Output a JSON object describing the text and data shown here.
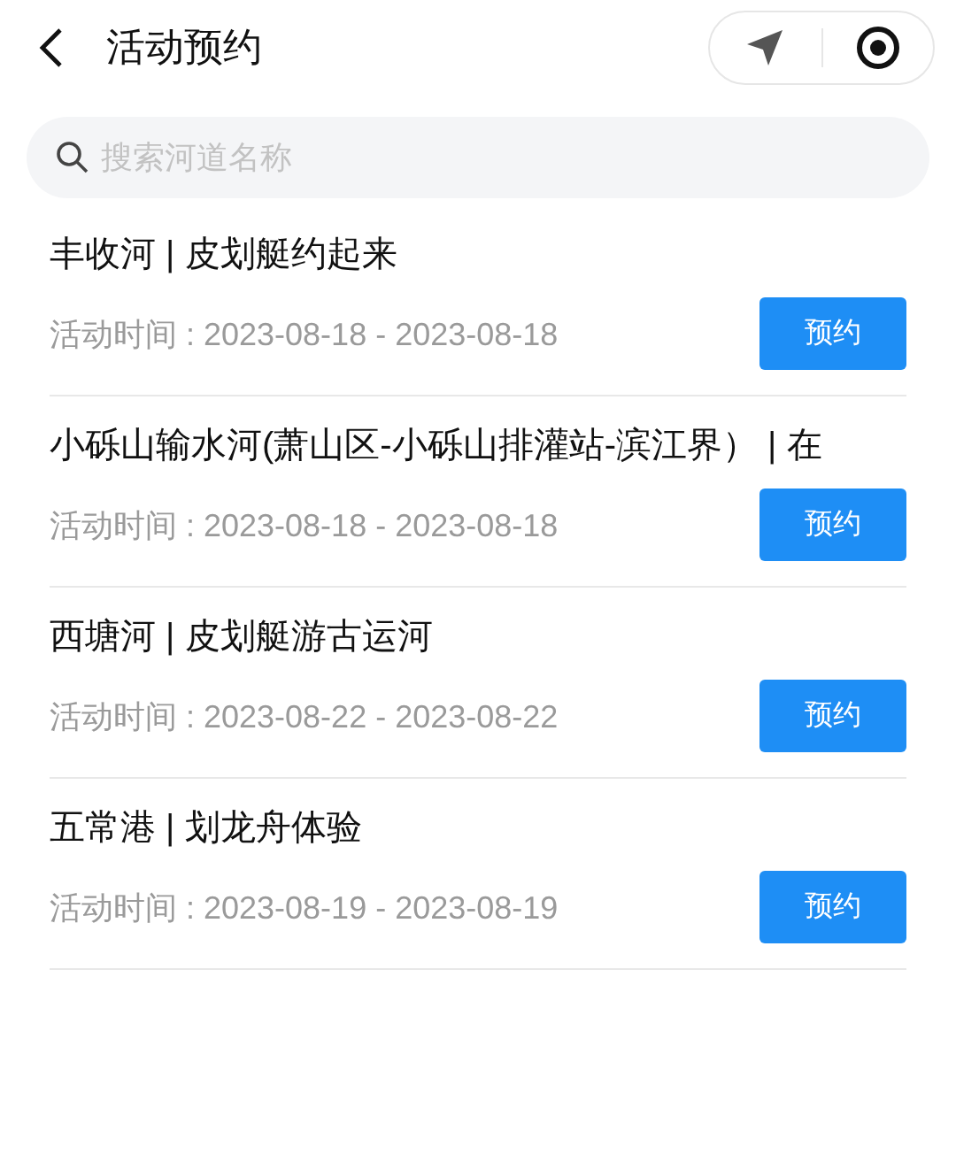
{
  "header": {
    "title": "活动预约"
  },
  "search": {
    "placeholder": "搜索河道名称"
  },
  "activities": [
    {
      "title": "丰收河 | 皮划艇约起来",
      "time": "活动时间 : 2023-08-18 - 2023-08-18",
      "button": "预约"
    },
    {
      "title": "小砾山输水河(萧山区-小砾山排灌站-滨江界） | 在",
      "time": "活动时间 : 2023-08-18 - 2023-08-18",
      "button": "预约"
    },
    {
      "title": "西塘河 | 皮划艇游古运河",
      "time": "活动时间 : 2023-08-22 - 2023-08-22",
      "button": "预约"
    },
    {
      "title": "五常港 | 划龙舟体验",
      "time": "活动时间 : 2023-08-19 - 2023-08-19",
      "button": "预约"
    }
  ]
}
